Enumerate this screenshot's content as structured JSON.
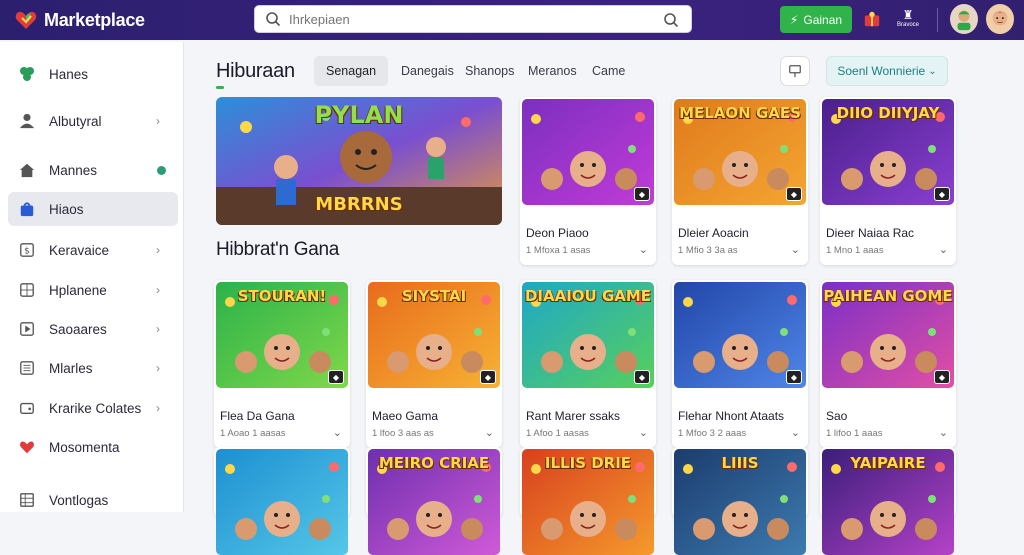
{
  "app": {
    "name": "Marketplace"
  },
  "search": {
    "placeholder": "Ihrkepiaen"
  },
  "topbar": {
    "deploy_label": "Gainan",
    "small_label": "Bravoce"
  },
  "sidebar": {
    "items": [
      {
        "label": "Hanes",
        "icon": "clover-icon",
        "active": false
      },
      {
        "label": "Albutyral",
        "icon": "person-icon",
        "active": false
      },
      {
        "label": "Mannes",
        "icon": "home-icon",
        "active": false
      },
      {
        "label": "Hiaos",
        "icon": "bag-icon",
        "active": true
      },
      {
        "label": "Keravaice",
        "icon": "dollar-icon",
        "active": false
      },
      {
        "label": "Hplanene",
        "icon": "grid-icon",
        "active": false
      },
      {
        "label": "Saoaares",
        "icon": "play-icon",
        "active": false
      },
      {
        "label": "Mlarles",
        "icon": "list-icon",
        "active": false
      },
      {
        "label": "Krarike Colates",
        "icon": "wallet-icon",
        "active": false
      },
      {
        "label": "Mosomenta",
        "icon": "heart-icon",
        "active": false
      },
      {
        "label": "Vontlogas",
        "icon": "table-icon",
        "active": false
      }
    ]
  },
  "main": {
    "title": "Hiburaan",
    "tabs": [
      "Senagan",
      "Danegais",
      "Shanops",
      "Meranos",
      "Came"
    ],
    "sort_label": "Soenl Wonnierie",
    "section_title": "Hibbrat'n Gana",
    "hero": {
      "title_top": "PYLAN",
      "title_bottom": "MBRRNS"
    },
    "cards_row1": [
      {
        "title": "Deon Piaoo",
        "meta": "1 Mfoxa 1 asas",
        "thumb_text": "",
        "colors": [
          "#7b2fbf",
          "#c23bd8"
        ]
      },
      {
        "title": "Dleier Aoacin",
        "meta": "1 Mfio 3 3a as",
        "thumb_text": "MELAON GAES",
        "colors": [
          "#e07a1c",
          "#f4a632"
        ]
      },
      {
        "title": "Dieer Naiaa Rac",
        "meta": "1 Mno 1 aaas",
        "thumb_text": "DIIO DIIYJAY",
        "colors": [
          "#4a1f8c",
          "#8a3fd1"
        ]
      }
    ],
    "cards_row2": [
      {
        "title": "Flea Da Gana",
        "meta": "1 Aoao 1 aasas",
        "thumb_text": "STOURAN!",
        "colors": [
          "#2bb24a",
          "#7fd84a"
        ]
      },
      {
        "title": "Maeo Gama",
        "meta": "1 lfoo 3 aas as",
        "thumb_text": "SIYSTAI",
        "colors": [
          "#e86b1c",
          "#f7b234"
        ]
      },
      {
        "title": "Rant Marer ssaks",
        "meta": "1 Afoo 1 aasas",
        "thumb_text": "DIAAIOU GAME",
        "colors": [
          "#1ea7c9",
          "#57d05b"
        ]
      },
      {
        "title": "Flehar Nhont Ataats",
        "meta": "1 Mfoo 3 2 aaas",
        "thumb_text": "",
        "colors": [
          "#2146a8",
          "#4f86e8"
        ]
      },
      {
        "title": "Sao",
        "meta": "1 lifoo 1 aaas",
        "thumb_text": "PAIHEAN GOME",
        "colors": [
          "#7a2fc7",
          "#e24fa5"
        ]
      }
    ],
    "cards_row3": [
      {
        "title": "",
        "meta": "",
        "thumb_text": "",
        "colors": [
          "#1d8fd1",
          "#55c7e8"
        ]
      },
      {
        "title": "",
        "meta": "",
        "thumb_text": "MEIRO CRIAE",
        "colors": [
          "#6d2fae",
          "#d05ad8"
        ]
      },
      {
        "title": "",
        "meta": "",
        "thumb_text": "ILLIS DRIE",
        "colors": [
          "#d8401f",
          "#f59a2c"
        ]
      },
      {
        "title": "",
        "meta": "",
        "thumb_text": "LIIIS",
        "colors": [
          "#1c3c6e",
          "#3d7bb0"
        ]
      },
      {
        "title": "",
        "meta": "",
        "thumb_text": "YAIPAIRE",
        "colors": [
          "#3a1e7a",
          "#b542c8"
        ]
      }
    ]
  }
}
